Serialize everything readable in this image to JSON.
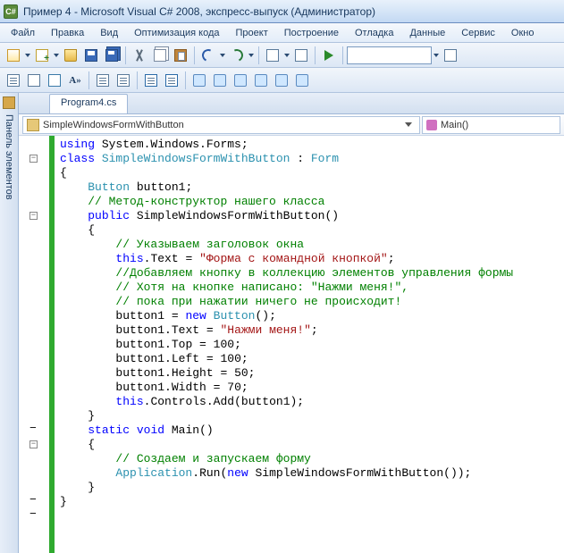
{
  "window": {
    "title": "Пример 4 - Microsoft Visual C# 2008, экспресс-выпуск (Администратор)"
  },
  "menu": [
    "Файл",
    "Правка",
    "Вид",
    "Оптимизация кода",
    "Проект",
    "Построение",
    "Отладка",
    "Данные",
    "Сервис",
    "Окно"
  ],
  "tab": {
    "label": "Program4.cs"
  },
  "nav": {
    "class": "SimpleWindowsFormWithButton",
    "member": "Main()"
  },
  "sidebar": {
    "label": "Панель элементов"
  },
  "code": {
    "tokens": {
      "using": "using",
      "class": "class",
      "public": "public",
      "static": "static",
      "void": "void",
      "new": "new",
      "this": "this",
      "System_Windows_Forms": "System.Windows.Forms",
      "SimpleWindowsFormWithButton": "SimpleWindowsFormWithButton",
      "Form": "Form",
      "Button": "Button",
      "Application": "Application",
      "Main": "Main",
      "button1": "button1",
      "Text": "Text",
      "Top": "Top",
      "Left": "Left",
      "Height": "Height",
      "Width": "Width",
      "Controls_Add": "Controls.Add",
      "Run": "Run"
    },
    "comments": {
      "c1": "// Метод-конструктор нашего класса",
      "c2": "// Указываем заголовок окна",
      "c3": "//Добавляем кнопку в коллекцию элементов управления формы",
      "c4": "// Хотя на кнопке написано: \"Нажми меня!\",",
      "c5": "// пока при нажатии ничего не происходит!",
      "c6": "// Создаем и запускаем форму"
    },
    "strings": {
      "s1": "\"Форма с командной кнопкой\"",
      "s2": "\"Нажми меня!\""
    },
    "numbers": {
      "n100a": "100",
      "n100b": "100",
      "n50": "50",
      "n70": "70"
    }
  }
}
